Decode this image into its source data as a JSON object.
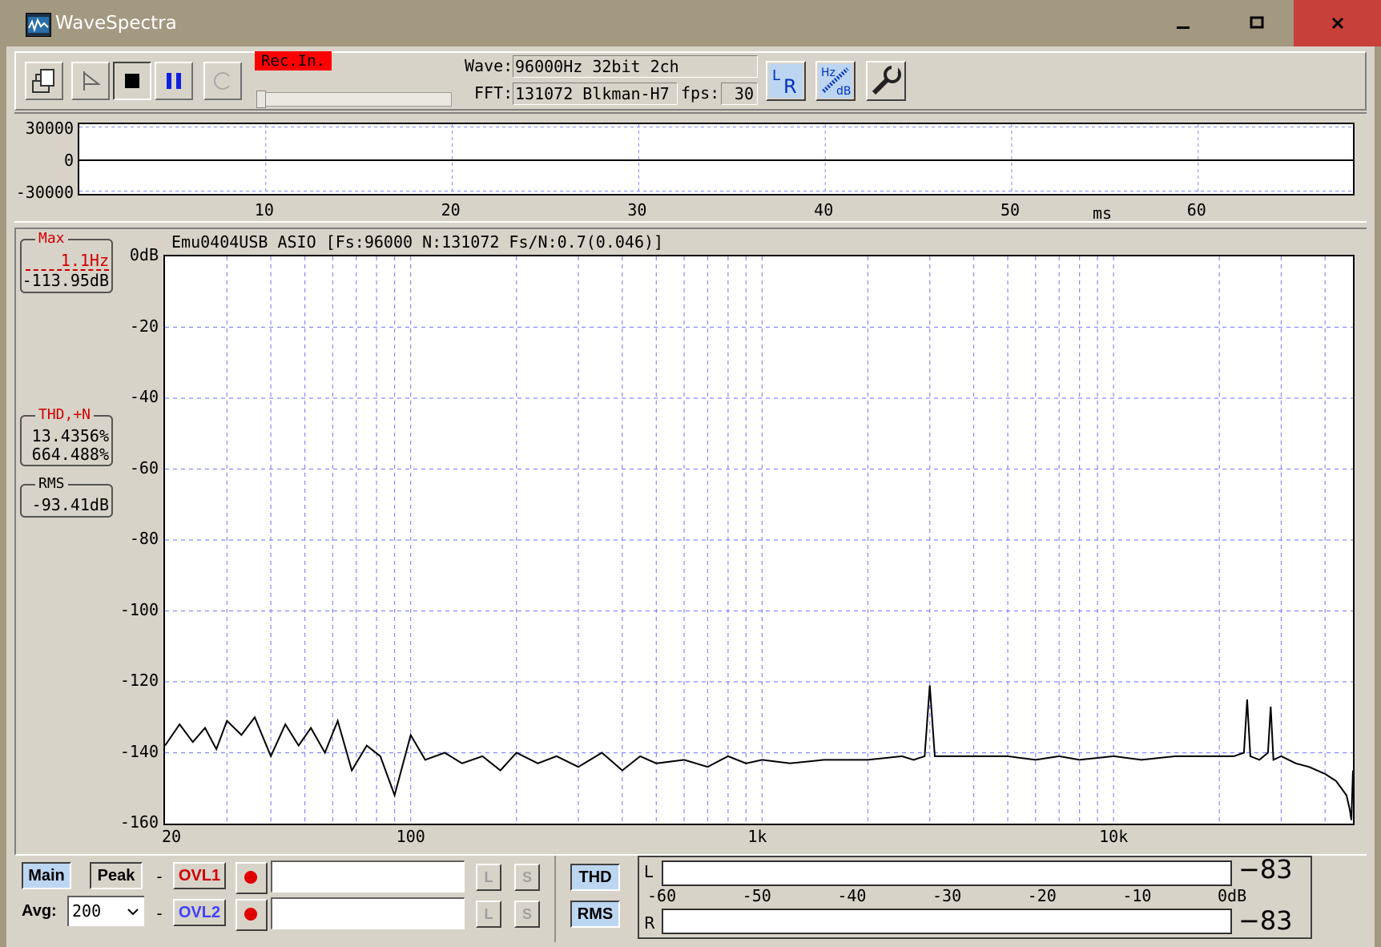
{
  "window": {
    "title": "WaveSpectra",
    "minimize": "‒",
    "maximize": "□",
    "close": "✕"
  },
  "toolbar": {
    "rec_in_label": "Rec.In.",
    "wave_label": "Wave:",
    "wave_value": "96000Hz 32bit 2ch",
    "fft_label": "FFT:",
    "fft_value": "131072 Blkman-H7",
    "fps_label": "fps:",
    "fps_value": "30",
    "lr_button": "LR",
    "hz_db_button": "Hz dB",
    "slider_level": 0.0,
    "icons": [
      "open-file-icon",
      "play-icon",
      "stop-icon",
      "pause-icon",
      "loop-icon",
      "lr-channel-icon",
      "hz-db-scale-icon",
      "settings-wrench-icon"
    ]
  },
  "waveform": {
    "y_labels": [
      "30000",
      "0",
      "-30000"
    ],
    "x_labels": [
      "10",
      "20",
      "30",
      "40",
      "50",
      "60"
    ],
    "x_unit": "ms",
    "ylim": [
      -30000,
      30000
    ],
    "xlim": [
      0,
      68.3
    ]
  },
  "spectrum": {
    "device_info": "Emu0404USB ASIO   [Fs:96000  N:131072  Fs/N:0.7(0.046)]",
    "y_labels": [
      "0dB",
      "-20",
      "-40",
      "-60",
      "-80",
      "-100",
      "-120",
      "-140",
      "-160"
    ],
    "x_labels": [
      "20",
      "100",
      "1k",
      "10k"
    ],
    "max_title": "Max",
    "max_freq": "1.1Hz",
    "max_level": "-113.95dB",
    "thd_title": "THD,+N",
    "thd_value": "13.4356%",
    "thdn_value": "664.488%",
    "rms_title": "RMS",
    "rms_value": "-93.41dB"
  },
  "chart_data": {
    "type": "line",
    "x_scale": "log",
    "xlim": [
      20,
      48000
    ],
    "ylim": [
      -160,
      0
    ],
    "series": [
      {
        "x": [
          20,
          22,
          24,
          26,
          28,
          30,
          33,
          36,
          40,
          44,
          48,
          52,
          57,
          62,
          68,
          75,
          82,
          90,
          100,
          110,
          125,
          140,
          160,
          180,
          200,
          230,
          260,
          300,
          350,
          400,
          450,
          500,
          600,
          700,
          800,
          900,
          1000,
          1200,
          1500,
          2000,
          2500,
          2700,
          2900,
          3000,
          3100,
          3300,
          4000,
          5000,
          6000,
          7000,
          8000,
          10000,
          12000,
          15000,
          18000,
          20000,
          22000,
          23500,
          24000,
          24500,
          26000,
          27500,
          28000,
          28500,
          30000,
          33000,
          36000,
          40000,
          43000,
          46000,
          47000,
          47500,
          48000
        ],
        "y": [
          -138,
          -132,
          -137,
          -133,
          -139,
          -131,
          -135,
          -130,
          -141,
          -132,
          -138,
          -133,
          -140,
          -131,
          -145,
          -138,
          -141,
          -152,
          -135,
          -142,
          -140,
          -143,
          -141,
          -145,
          -140,
          -143,
          -141,
          -144,
          -140,
          -145,
          -141,
          -143,
          -142,
          -144,
          -141,
          -143,
          -142,
          -143,
          -142,
          -142,
          -141,
          -142,
          -141,
          -121,
          -141,
          -141,
          -141,
          -141,
          -142,
          -141,
          -142,
          -141,
          -142,
          -141,
          -141,
          -141,
          -141,
          -140,
          -125,
          -141,
          -142,
          -140,
          -127,
          -142,
          -141,
          -143,
          -144,
          -146,
          -148,
          -152,
          -156,
          -159,
          -145
        ]
      }
    ]
  },
  "bottom": {
    "main_button": "Main",
    "peak_button": "Peak",
    "avg_label": "Avg:",
    "avg_value": "200",
    "dash": "-",
    "ovl1_button": "OVL1",
    "ovl2_button": "OVL2",
    "l_button": "L",
    "s_button": "S",
    "thd_button": "THD",
    "rms_button": "RMS",
    "ovl1_color": "#d00000",
    "ovl2_color": "#4040ff"
  },
  "meter": {
    "left_label": "L",
    "right_label": "R",
    "left_value": "−83",
    "right_value": "−83",
    "scale": [
      "-60",
      "-50",
      "-40",
      "-30",
      "-20",
      "-10",
      "0dB"
    ]
  }
}
